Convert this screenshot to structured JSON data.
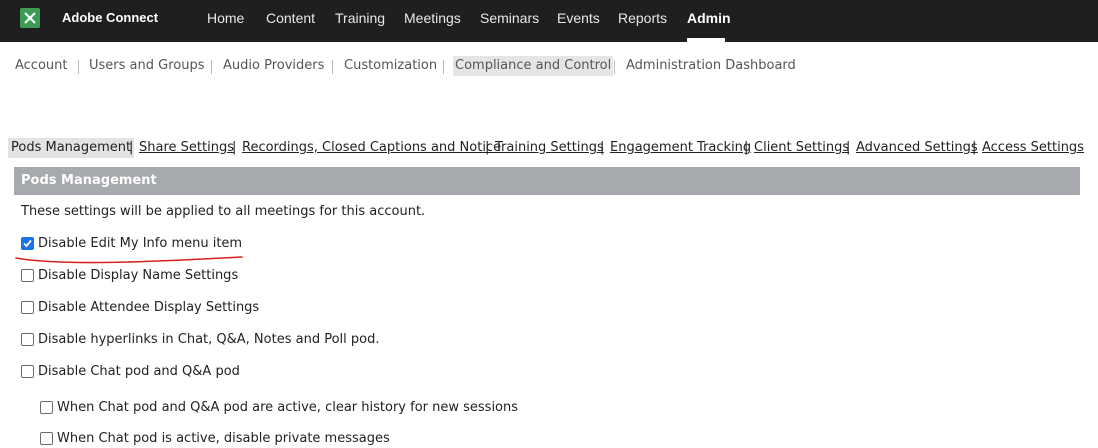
{
  "app": {
    "title": "Adobe Connect",
    "logo_icon": "adobe-connect-logo-icon"
  },
  "topnav": [
    "Home",
    "Content",
    "Training",
    "Meetings",
    "Seminars",
    "Events",
    "Reports",
    "Admin"
  ],
  "subnav": [
    "Account",
    "Users and Groups",
    "Audio Providers",
    "Customization",
    "Compliance and Control",
    "Administration Dashboard"
  ],
  "tabs": [
    "Pods Management",
    "Share Settings",
    "Recordings, Closed Captions and Notice",
    "Training Settings",
    "Engagement Tracking",
    "Client Settings",
    "Advanced Settings",
    "Access Settings"
  ],
  "panel": {
    "title": "Pods Management",
    "intro": "These settings will be applied to all meetings for this account.",
    "options": [
      {
        "label": "Disable Edit My Info menu item",
        "checked": true
      },
      {
        "label": "Disable Display Name Settings",
        "checked": false
      },
      {
        "label": "Disable Attendee Display Settings",
        "checked": false
      },
      {
        "label": "Disable hyperlinks in Chat, Q&A, Notes and Poll pod.",
        "checked": false
      },
      {
        "label": "Disable Chat pod and Q&A pod",
        "checked": false
      },
      {
        "label": "When Chat pod and Q&A pod are active, clear history for new sessions",
        "checked": false
      },
      {
        "label": "When Chat pod is active, disable private messages",
        "checked": false
      }
    ]
  },
  "colors": {
    "topbar": "#1f1f1f",
    "panel_header": "#a6a9ad",
    "annotation": "#d9201e",
    "checkbox": "#1a73e8"
  }
}
